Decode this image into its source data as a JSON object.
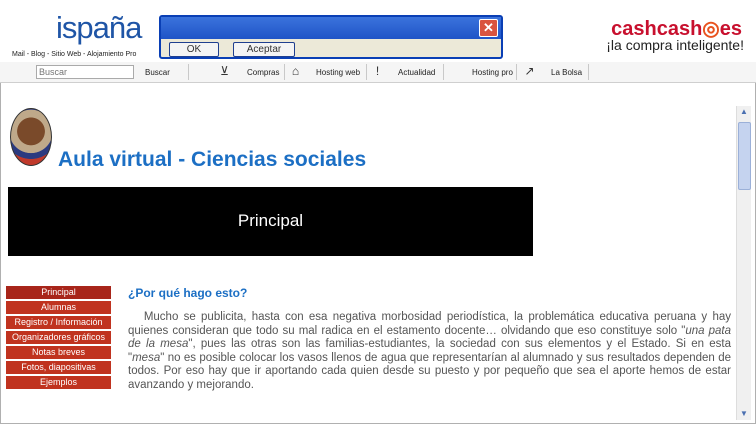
{
  "banner": {
    "logo": "ispaña",
    "logo_sub": "Mail - Blog - Sitio Web - Alojamiento Pro",
    "cash_logo": "cashcash",
    "cash_logo_es": "es",
    "cash_slogan": "¡la compra inteligente!"
  },
  "dialog": {
    "ok_label": "OK",
    "accept_label": "Aceptar",
    "close_glyph": "✕"
  },
  "navbar": {
    "search_placeholder": "Buscar",
    "search_button": "Buscar",
    "items": [
      {
        "label": "Compras",
        "icon": "basket-icon"
      },
      {
        "label": "Hosting web",
        "icon": "house-icon"
      },
      {
        "label": "Actualidad",
        "icon": "alert-icon"
      },
      {
        "label": "Hosting pro",
        "icon": ""
      },
      {
        "label": "La Bolsa",
        "icon": "chart-icon"
      }
    ]
  },
  "page": {
    "title": "Aula virtual - Ciencias sociales",
    "banner_text": "Principal",
    "menu": [
      "Principal",
      "Alumnas",
      "Registro / Información",
      "Organizadores gráficos",
      "Notas breves",
      "Fotos, diapositivas",
      "Ejemplos"
    ],
    "question": "¿Por qué hago esto?",
    "paragraph_1": "Mucho se publicita, hasta con esa negativa morbosidad periodística, la problemática educativa peruana y hay quienes consideran que todo su mal radica en el estamento docente… olvidando que eso constituye solo \"",
    "paragraph_italic_1": "una pata de la mesa",
    "paragraph_2": "\", pues las otras son las familias-estudiantes, la sociedad con sus elementos y el Estado. Si en esta \"",
    "paragraph_italic_2": "mesa",
    "paragraph_3": "\" no es posible colocar los vasos llenos de agua que representarían al alumnado y sus resultados dependen de todos. Por eso hay que ir aportando cada quien desde su puesto y por pequeño que sea el aporte hemos de estar avanzando y mejorando."
  },
  "colors": {
    "title_blue": "#1c6fc4",
    "menu_red": "#c0331f",
    "banner_black": "#000000"
  }
}
